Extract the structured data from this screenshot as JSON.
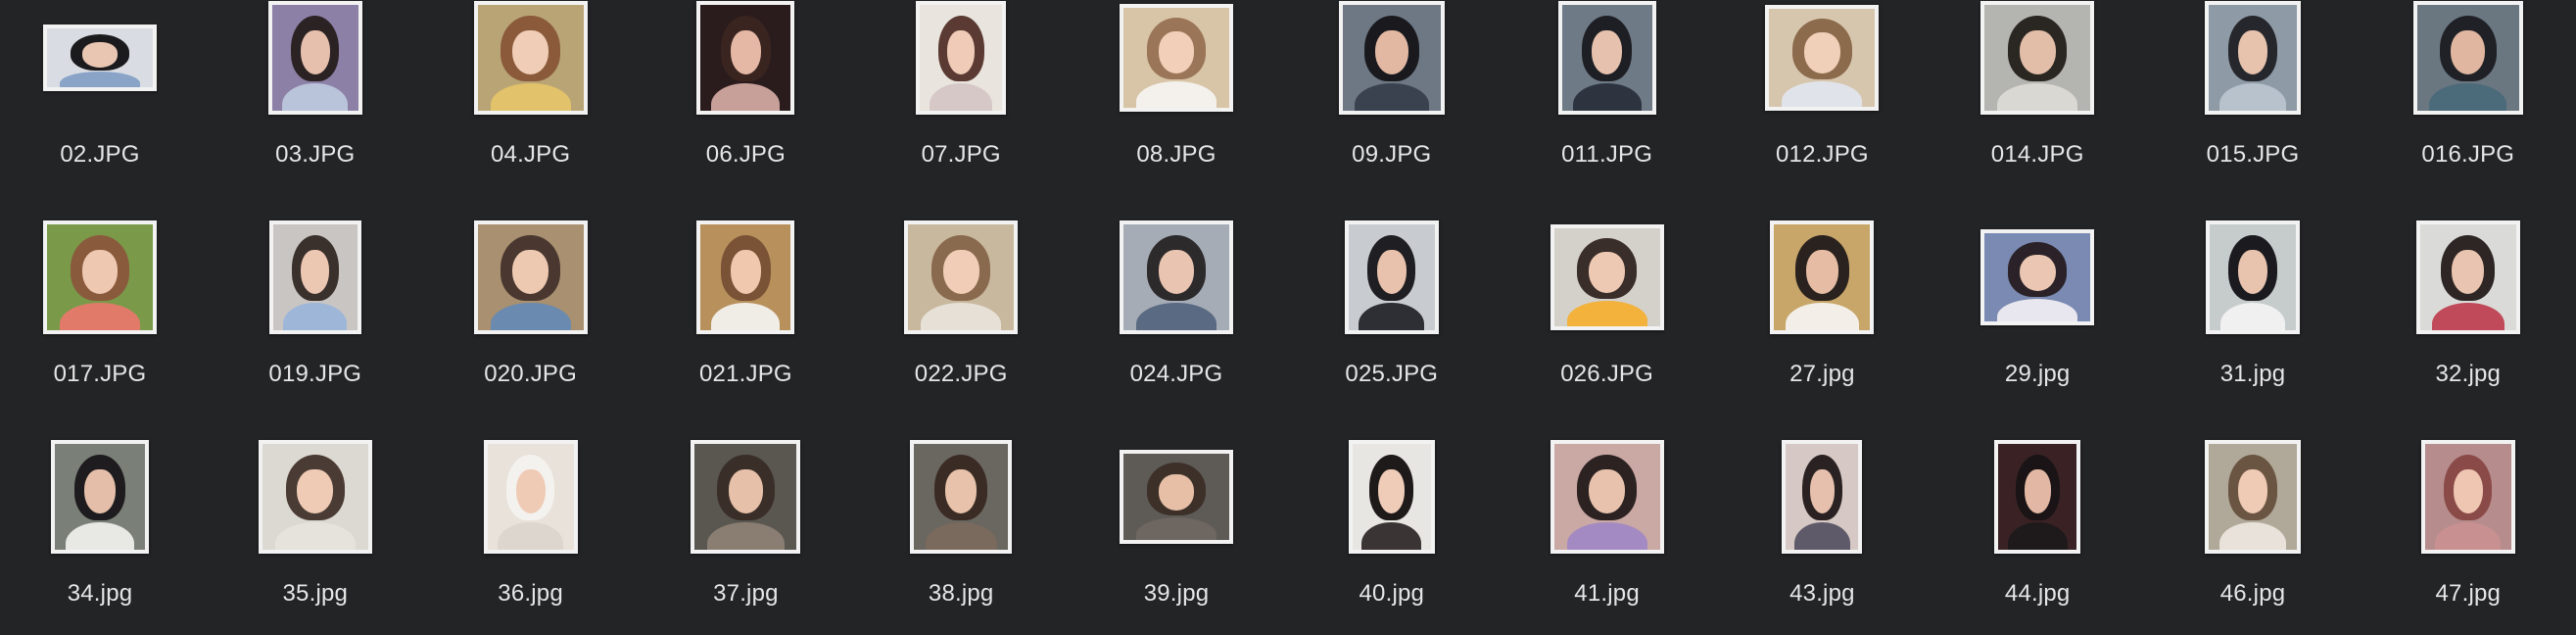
{
  "files": [
    {
      "name": "02.JPG",
      "tw": 116,
      "th": 68,
      "bg": "#d9dde3",
      "hair": "#1b1a1c",
      "face": "#e9c6b2",
      "body": "#8aa4c8"
    },
    {
      "name": "03.JPG",
      "tw": 96,
      "th": 116,
      "bg": "#8c80a6",
      "hair": "#2b2224",
      "face": "#e6c0ac",
      "body": "#b9c3d9"
    },
    {
      "name": "04.JPG",
      "tw": 116,
      "th": 116,
      "bg": "#b9a476",
      "hair": "#8a5a3a",
      "face": "#f0cdb6",
      "body": "#e2c26a"
    },
    {
      "name": "06.JPG",
      "tw": 100,
      "th": 116,
      "bg": "#2a1c1c",
      "hair": "#3a2420",
      "face": "#e4b8a4",
      "body": "#c8a09a"
    },
    {
      "name": "07.JPG",
      "tw": 92,
      "th": 116,
      "bg": "#e9e4de",
      "hair": "#5a3a32",
      "face": "#f0ccb8",
      "body": "#d7c8c8"
    },
    {
      "name": "08.JPG",
      "tw": 116,
      "th": 110,
      "bg": "#d8c4a6",
      "hair": "#9a7558",
      "face": "#f1cfb8",
      "body": "#f4f1ec"
    },
    {
      "name": "09.JPG",
      "tw": 108,
      "th": 116,
      "bg": "#6e7884",
      "hair": "#1a1a1e",
      "face": "#e2b8a2",
      "body": "#3a4250"
    },
    {
      "name": "011.JPG",
      "tw": 100,
      "th": 116,
      "bg": "#6e7a86",
      "hair": "#1e1f24",
      "face": "#e6c1ad",
      "body": "#2d3440"
    },
    {
      "name": "012.JPG",
      "tw": 116,
      "th": 108,
      "bg": "#d7c6ae",
      "hair": "#8c6a4c",
      "face": "#f1d0ba",
      "body": "#e0e4ea"
    },
    {
      "name": "014.JPG",
      "tw": 116,
      "th": 116,
      "bg": "#b4b4b0",
      "hair": "#2a2622",
      "face": "#e2bea8",
      "body": "#dad8d2"
    },
    {
      "name": "015.JPG",
      "tw": 98,
      "th": 116,
      "bg": "#8e9aa6",
      "hair": "#25272c",
      "face": "#e7c3ae",
      "body": "#b8c2cc"
    },
    {
      "name": "016.JPG",
      "tw": 112,
      "th": 116,
      "bg": "#6a7680",
      "hair": "#1f2126",
      "face": "#e0b6a0",
      "body": "#4b6a7a"
    },
    {
      "name": "017.JPG",
      "tw": 116,
      "th": 116,
      "bg": "#7a9a4a",
      "hair": "#8a5a3c",
      "face": "#efc8b2",
      "body": "#e27a6a"
    },
    {
      "name": "019.JPG",
      "tw": 94,
      "th": 116,
      "bg": "#c9c5c2",
      "hair": "#3a302c",
      "face": "#ecc7b2",
      "body": "#9eb6d8"
    },
    {
      "name": "020.JPG",
      "tw": 116,
      "th": 116,
      "bg": "#a89070",
      "hair": "#4a3830",
      "face": "#eec9b2",
      "body": "#6a8ab0"
    },
    {
      "name": "021.JPG",
      "tw": 100,
      "th": 116,
      "bg": "#b8905c",
      "hair": "#7a5236",
      "face": "#f0c8ae",
      "body": "#f0ece6"
    },
    {
      "name": "022.JPG",
      "tw": 116,
      "th": 116,
      "bg": "#c8b89e",
      "hair": "#8a6a4e",
      "face": "#f1cdb8",
      "body": "#e6e0d6"
    },
    {
      "name": "024.JPG",
      "tw": 116,
      "th": 116,
      "bg": "#a6acb6",
      "hair": "#2d2a2c",
      "face": "#e9c4b0",
      "body": "#5a6a82"
    },
    {
      "name": "025.JPG",
      "tw": 96,
      "th": 116,
      "bg": "#c8ccd0",
      "hair": "#1f1e22",
      "face": "#e8c2ac",
      "body": "#2e2f34"
    },
    {
      "name": "026.JPG",
      "tw": 116,
      "th": 108,
      "bg": "#d4d0ca",
      "hair": "#3a2e2a",
      "face": "#edc8b2",
      "body": "#f2b23c"
    },
    {
      "name": "27.jpg",
      "tw": 106,
      "th": 116,
      "bg": "#c8a66a",
      "hair": "#2a221e",
      "face": "#e6bda4",
      "body": "#f3efe8"
    },
    {
      "name": "29.jpg",
      "tw": 116,
      "th": 98,
      "bg": "#7a8ab2",
      "hair": "#2a2228",
      "face": "#ebc6b2",
      "body": "#e8e6ee"
    },
    {
      "name": "31.jpg",
      "tw": 96,
      "th": 116,
      "bg": "#c6cccc",
      "hair": "#1b1a1e",
      "face": "#e8c3ae",
      "body": "#f0f0f0"
    },
    {
      "name": "32.jpg",
      "tw": 106,
      "th": 116,
      "bg": "#dadbd8",
      "hair": "#2e2624",
      "face": "#e9c4b0",
      "body": "#c04a5a"
    },
    {
      "name": "34.jpg",
      "tw": 100,
      "th": 116,
      "bg": "#7a8078",
      "hair": "#1e1c1e",
      "face": "#e4bea8",
      "body": "#e8e8e4"
    },
    {
      "name": "35.jpg",
      "tw": 116,
      "th": 116,
      "bg": "#dcd8d2",
      "hair": "#4a3c34",
      "face": "#efcbb6",
      "body": "#e6e2dc"
    },
    {
      "name": "36.jpg",
      "tw": 96,
      "th": 116,
      "bg": "#e8e2da",
      "hair": "#f4f2ee",
      "face": "#efcbb6",
      "body": "#dcd6ce"
    },
    {
      "name": "37.jpg",
      "tw": 112,
      "th": 116,
      "bg": "#5a5650",
      "hair": "#3a2e28",
      "face": "#e6c0a8",
      "body": "#8a7e72"
    },
    {
      "name": "38.jpg",
      "tw": 104,
      "th": 116,
      "bg": "#6a6660",
      "hair": "#3a2c24",
      "face": "#e8c2aa",
      "body": "#7a6a5e"
    },
    {
      "name": "39.jpg",
      "tw": 116,
      "th": 96,
      "bg": "#5e5a56",
      "hair": "#3c3029",
      "face": "#e6bfa6",
      "body": "#6e6660"
    },
    {
      "name": "40.jpg",
      "tw": 88,
      "th": 116,
      "bg": "#e8e6e2",
      "hair": "#1e1a1a",
      "face": "#efccb8",
      "body": "#3a3434"
    },
    {
      "name": "41.jpg",
      "tw": 116,
      "th": 116,
      "bg": "#caa8a4",
      "hair": "#2c2222",
      "face": "#e8c2ac",
      "body": "#a38ac2"
    },
    {
      "name": "43.jpg",
      "tw": 82,
      "th": 116,
      "bg": "#d6c8c4",
      "hair": "#2a2222",
      "face": "#e6c0ac",
      "body": "#5e5a6a"
    },
    {
      "name": "44.jpg",
      "tw": 88,
      "th": 116,
      "bg": "#3a2224",
      "hair": "#1a1416",
      "face": "#e2b8a4",
      "body": "#1e1a1c"
    },
    {
      "name": "46.jpg",
      "tw": 98,
      "th": 116,
      "bg": "#b0a898",
      "hair": "#6a5442",
      "face": "#efcab4",
      "body": "#e8e2da"
    },
    {
      "name": "47.jpg",
      "tw": 96,
      "th": 116,
      "bg": "#b68c8c",
      "hair": "#8a4a48",
      "face": "#efc6b2",
      "body": "#c89090"
    }
  ]
}
